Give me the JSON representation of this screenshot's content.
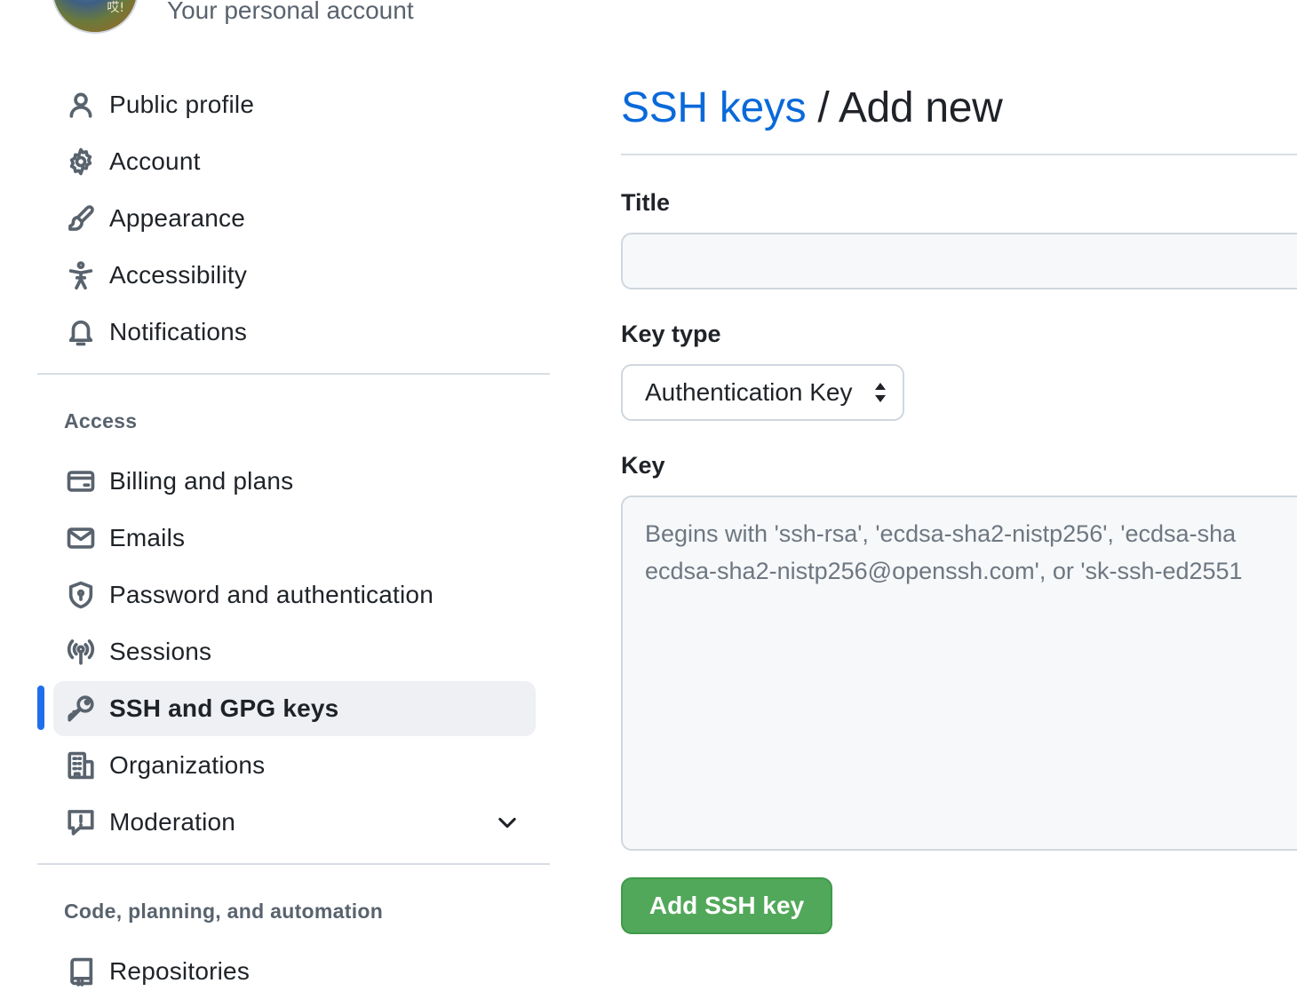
{
  "header": {
    "subtitle": "Your personal account",
    "avatar_glyph": "哎!"
  },
  "sidebar": {
    "items": [
      {
        "label": "Public profile",
        "icon": "person-icon"
      },
      {
        "label": "Account",
        "icon": "gear-icon"
      },
      {
        "label": "Appearance",
        "icon": "paintbrush-icon"
      },
      {
        "label": "Accessibility",
        "icon": "accessibility-icon"
      },
      {
        "label": "Notifications",
        "icon": "bell-icon"
      }
    ],
    "sections": [
      {
        "heading": "Access",
        "items": [
          {
            "label": "Billing and plans",
            "icon": "credit-card-icon"
          },
          {
            "label": "Emails",
            "icon": "mail-icon"
          },
          {
            "label": "Password and authentication",
            "icon": "shield-lock-icon"
          },
          {
            "label": "Sessions",
            "icon": "broadcast-icon"
          },
          {
            "label": "SSH and GPG keys",
            "icon": "key-icon",
            "selected": true
          },
          {
            "label": "Organizations",
            "icon": "organization-icon"
          },
          {
            "label": "Moderation",
            "icon": "report-icon",
            "expandable": true
          }
        ]
      },
      {
        "heading": "Code, planning, and automation",
        "items": [
          {
            "label": "Repositories",
            "icon": "repo-icon"
          }
        ]
      }
    ]
  },
  "main": {
    "breadcrumb_link": "SSH keys",
    "separator": "/",
    "title": "Add new",
    "title_field": {
      "label": "Title",
      "value": "",
      "placeholder": ""
    },
    "key_type": {
      "label": "Key type",
      "selected": "Authentication Key"
    },
    "key_field": {
      "label": "Key",
      "value": "",
      "placeholder": "Begins with 'ssh-rsa', 'ecdsa-sha2-nistp256', 'ecdsa-sha\necdsa-sha2-nistp256@openssh.com', or 'sk-ssh-ed2551"
    },
    "submit_label": "Add SSH key"
  },
  "colors": {
    "accent": "#0969da",
    "selected_indicator": "#1f6feb",
    "primary_button": "#52a85a"
  }
}
